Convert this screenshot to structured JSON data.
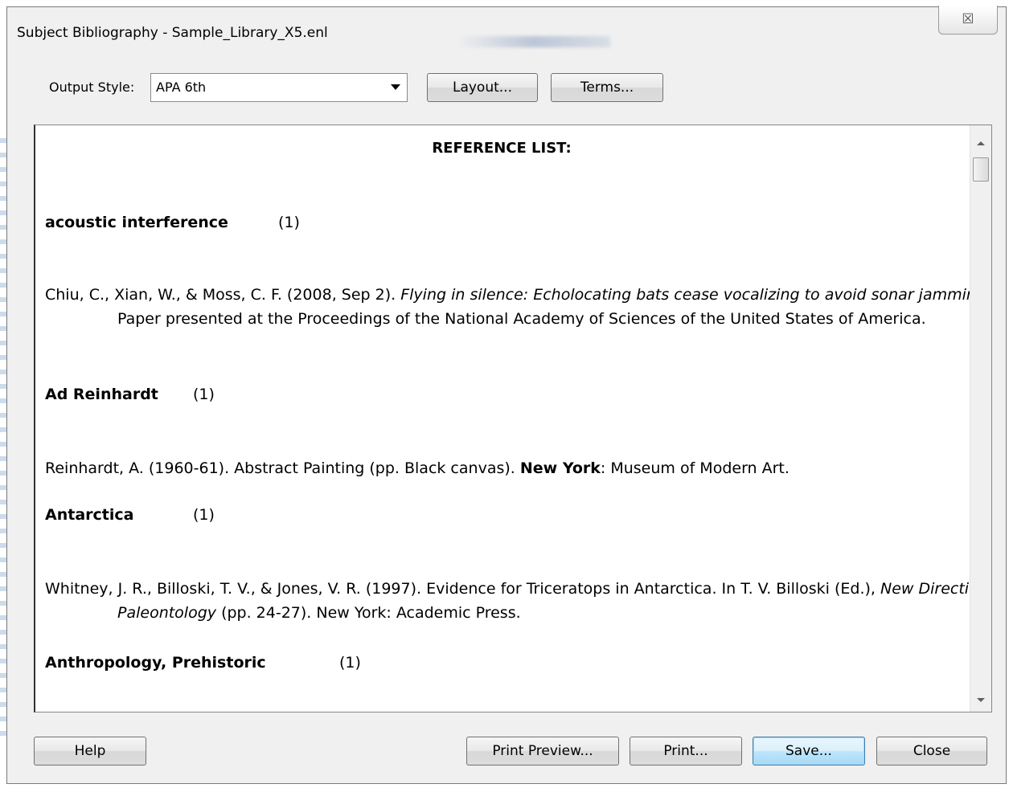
{
  "window": {
    "title": "Subject Bibliography - Sample_Library_X5.enl",
    "close_glyph": "☒"
  },
  "toolbar": {
    "output_style_label": "Output Style:",
    "output_style_value": "APA 6th",
    "layout_button": "Layout...",
    "terms_button": "Terms..."
  },
  "document": {
    "heading": "REFERENCE LIST:",
    "subjects": [
      {
        "term": "acoustic interference",
        "count": "(1)",
        "reference": {
          "before": "Chiu, C., Xian, W., & Moss, C. F. (2008, Sep 2). ",
          "italic": "Flying in silence: Echolocating bats cease vocalizing to avoid sonar jamming.",
          "after": " Paper presented at the Proceedings of the National Academy of Sciences of the United States of America."
        }
      },
      {
        "term": "Ad Reinhardt",
        "count": "(1)",
        "reference": {
          "before": "Reinhardt, A. (1960-61). Abstract Painting (pp. Black canvas). ",
          "bold": "New York",
          "after": ": Museum of Modern Art."
        }
      },
      {
        "term": "Antarctica",
        "count": "(1)",
        "reference": {
          "before": "Whitney, J. R., Billoski, T. V., & Jones, V. R. (1997). Evidence for Triceratops in Antarctica. In T. V. Billoski (Ed.), ",
          "italic": "New Directions in Paleontology",
          "after": " (pp. 24-27). New York: Academic Press."
        }
      },
      {
        "term": "Anthropology, Prehistoric",
        "count": "(1)"
      }
    ]
  },
  "footer": {
    "help_button": "Help",
    "print_preview_button": "Print Preview...",
    "print_button": "Print...",
    "save_button": "Save...",
    "close_button": "Close"
  }
}
